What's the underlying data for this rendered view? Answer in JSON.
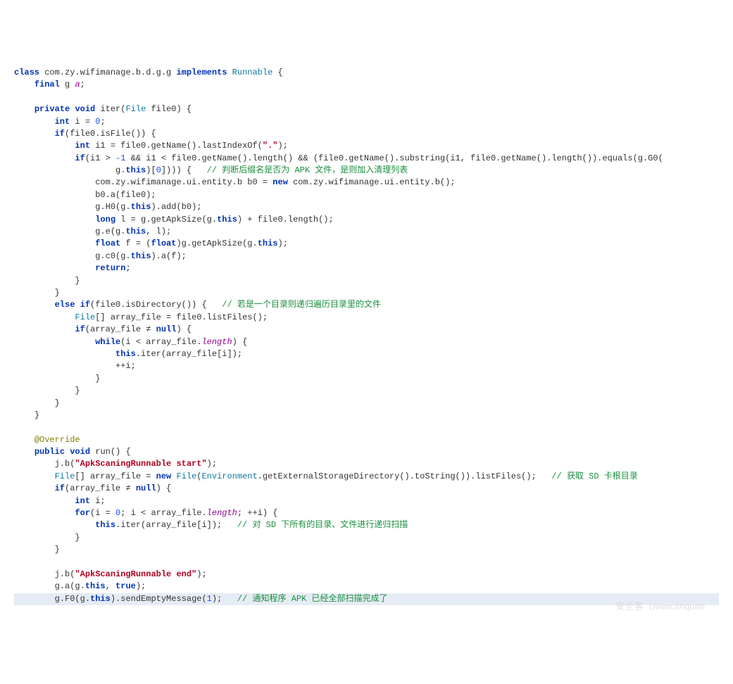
{
  "class_decl": {
    "kw_class": "class",
    "name": "com.zy.wifimanage.b.d.g.g",
    "kw_impl": "implements",
    "iface": "Runnable",
    "open": " {"
  },
  "field": {
    "kw_final": "final",
    "type": "g",
    "name": "a",
    "semi": ";"
  },
  "iter_sig": {
    "kw_private": "private",
    "kw_void": "void",
    "name": "iter",
    "paren_open": "(",
    "ptype": "File",
    "pname": " file0",
    "close": ") {"
  },
  "line_int_i": {
    "kw_int": "int",
    "rest": " i = ",
    "zero": "0",
    "semi": ";"
  },
  "if_isfile": {
    "kw_if": "if",
    "cond": "(file0.isFile()) {"
  },
  "i1_decl": {
    "kw_int": "int",
    "rest": " i1 = file0.getName().lastIndexOf(",
    "str": "\".\"",
    "close": ");"
  },
  "if_ext": {
    "kw_if": "if",
    "cond1": "(i1 > ",
    "num_neg1": "-1",
    "cond2": " && i1 < file0.getName().length() && (file0.getName().substring(i1, file0.getName().length()).equals(g.G0("
  },
  "if_ext_line2": {
    "pre": "g.",
    "kw_this": "this",
    "post": ")[",
    "zero": "0",
    "post2": "]))) {   ",
    "cmt": "// 判断后缀名是否为 APK 文件，是则加入清理列表"
  },
  "b0_decl_a": "com.zy.wifimanage.ui.entity.b b0 = ",
  "b0_decl_new": "new",
  "b0_decl_b": " com.zy.wifimanage.ui.entity.b();",
  "b0_a": "b0.a(file0);",
  "gH0_a": "g.H0(g.",
  "gH0_this": "this",
  "gH0_b": ").add(b0);",
  "long_a": "long",
  "long_b": " l = g.getApkSize(g.",
  "long_this": "this",
  "long_c": ") + file0.length();",
  "ge_a": "g.e(g.",
  "ge_this": "this",
  "ge_b": ", l);",
  "float_a": "float",
  "float_b": " f = (",
  "float_cast": "float",
  "float_c": ")g.getApkSize(g.",
  "float_this": "this",
  "float_d": ");",
  "gc0_a": "g.c0(g.",
  "gc0_this": "this",
  "gc0_b": ").a(f);",
  "kw_return": "return",
  "return_semi": ";",
  "brace": "}",
  "else_kw": "else if",
  "else_cond": "(file0.isDirectory()) {   ",
  "else_cmt": "// 若是一个目录则递归遍历目录里的文件",
  "listfiles_a": "File",
  "listfiles_b": "[] array_file = file0.listFiles();",
  "if_arr_a": "if",
  "if_arr_b": "(array_file ≠ ",
  "if_arr_null": "null",
  "if_arr_c": ") {",
  "while_a": "while",
  "while_b": "(i < array_file.",
  "while_len": "length",
  "while_c": ") {",
  "iter_call_a": "this",
  "iter_call_b": ".iter(array_file[i]);",
  "ppi": "++i;",
  "override": "@Override",
  "run_a": "public",
  "run_b": " void",
  "run_c": " run() {",
  "jb1_a": "j.b(",
  "jb1_s": "\"ApkScaningRunnable start\"",
  "jb1_b": ");",
  "arr2_a": "File",
  "arr2_b": "[] array_file = ",
  "arr2_new": "new",
  "arr2_c": " ",
  "arr2_file": "File",
  "arr2_d": "(",
  "arr2_env": "Environment",
  "arr2_e": ".getExternalStorageDirectory().toString()).listFiles();   ",
  "arr2_cmt": "// 获取 SD 卡根目录",
  "int_i2": "int",
  "int_i2b": " i;",
  "for_a": "for",
  "for_b": "(i = ",
  "for_zero": "0",
  "for_c": "; i < array_file.",
  "for_len": "length",
  "for_d": "; ++i) {",
  "iter2_a": "this",
  "iter2_b": ".iter(array_file[i]);   ",
  "iter2_cmt": "// 对 SD 下所有的目录、文件进行递归扫描",
  "jb2_a": "j.b(",
  "jb2_s": "\"ApkScaningRunnable end\"",
  "jb2_b": ");",
  "ga_a": "g.a(g.",
  "ga_this": "this",
  "ga_b": ", ",
  "ga_true": "true",
  "ga_c": ");",
  "gf0_a": "g.F0(g.",
  "gf0_this": "this",
  "gf0_b": ").sendEmptyMessage(",
  "gf0_one": "1",
  "gf0_c": ");   ",
  "gf0_cmt": "// 通知程序 APK 已经全部扫描完成了",
  "watermark": "安全客（www.anquan"
}
